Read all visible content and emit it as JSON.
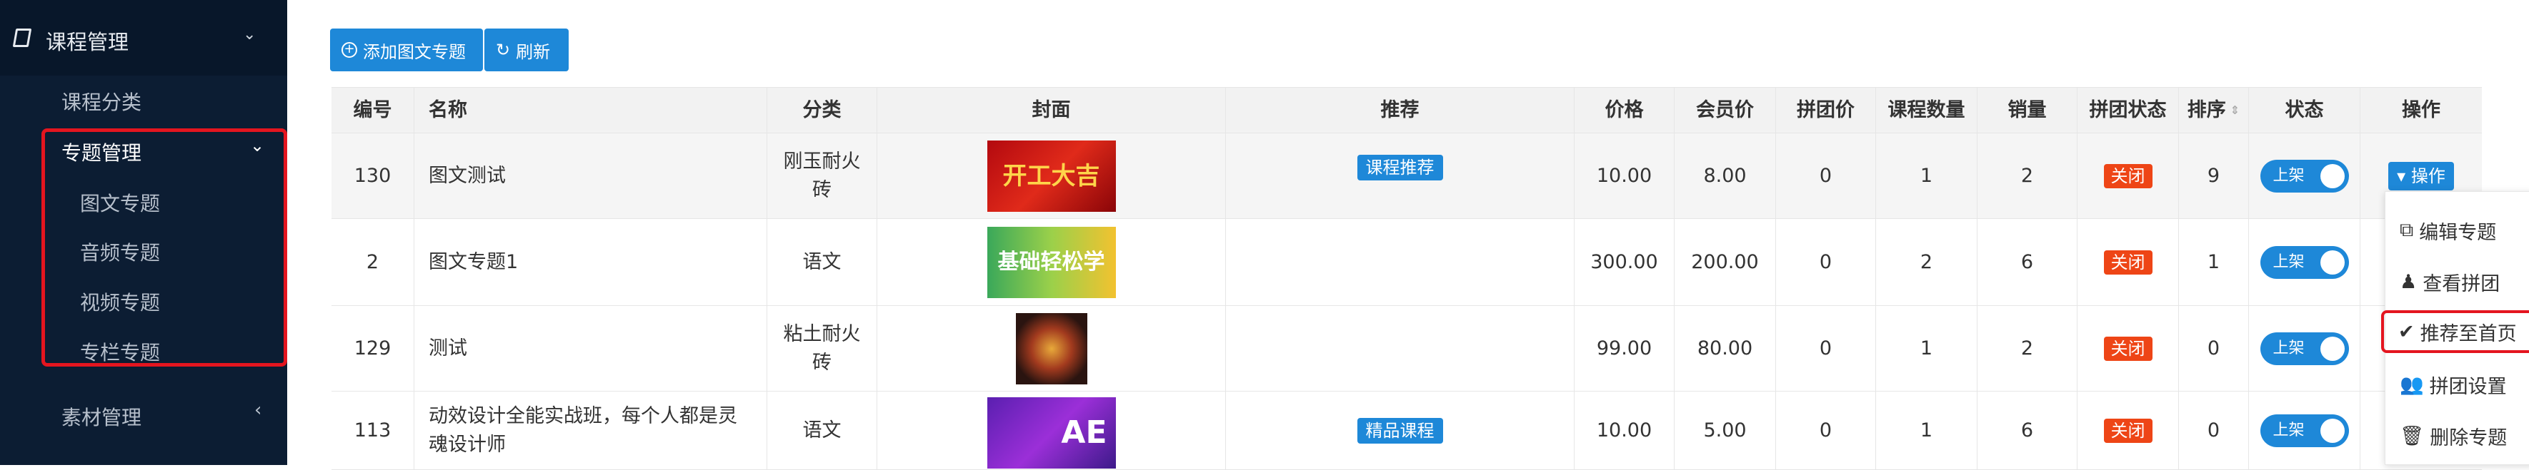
{
  "sidebar": {
    "course_mgmt": "课程管理",
    "course_category": "课程分类",
    "special_mgmt": "专题管理",
    "items": [
      "图文专题",
      "音频专题",
      "视频专题",
      "专栏专题"
    ],
    "material_mgmt": "素材管理"
  },
  "toolbar": {
    "add_label": "添加图文专题",
    "refresh_label": "刷新"
  },
  "table": {
    "headers": [
      "编号",
      "名称",
      "分类",
      "封面",
      "推荐",
      "价格",
      "会员价",
      "拼团价",
      "课程数量",
      "销量",
      "拼团状态",
      "排序",
      "状态",
      "操作"
    ],
    "rows": [
      {
        "id": "130",
        "name": "图文测试",
        "category": "刚玉耐火砖",
        "cover_text": "开工大吉",
        "recommend": "课程推荐",
        "price": "10.00",
        "member_price": "8.00",
        "group_price": "0",
        "course_count": "1",
        "sales": "2",
        "group_status": "关闭",
        "sort": "9",
        "status": "上架",
        "action": "操作"
      },
      {
        "id": "2",
        "name": "图文专题1",
        "category": "语文",
        "cover_text": "基础轻松学",
        "recommend": "",
        "price": "300.00",
        "member_price": "200.00",
        "group_price": "0",
        "course_count": "2",
        "sales": "6",
        "group_status": "关闭",
        "sort": "1",
        "status": "上架",
        "action": ""
      },
      {
        "id": "129",
        "name": "测试",
        "category": "粘土耐火砖",
        "cover_text": "",
        "recommend": "",
        "price": "99.00",
        "member_price": "80.00",
        "group_price": "0",
        "course_count": "1",
        "sales": "2",
        "group_status": "关闭",
        "sort": "0",
        "status": "上架",
        "action": ""
      },
      {
        "id": "113",
        "name": "动效设计全能实战班，每个人都是灵魂设计师",
        "category": "语文",
        "cover_text": "AE",
        "recommend": "精品课程",
        "price": "10.00",
        "member_price": "5.00",
        "group_price": "0",
        "course_count": "1",
        "sales": "6",
        "group_status": "关闭",
        "sort": "0",
        "status": "上架",
        "action": ""
      }
    ]
  },
  "dropdown": {
    "items": [
      "编辑专题",
      "查看拼团",
      "推荐至首页",
      "拼团设置",
      "删除专题"
    ]
  },
  "colors": {
    "sidebar_bg": "#0c1d33",
    "primary": "#1e88d8",
    "danger": "#ee4516",
    "highlight": "#e4151f"
  }
}
